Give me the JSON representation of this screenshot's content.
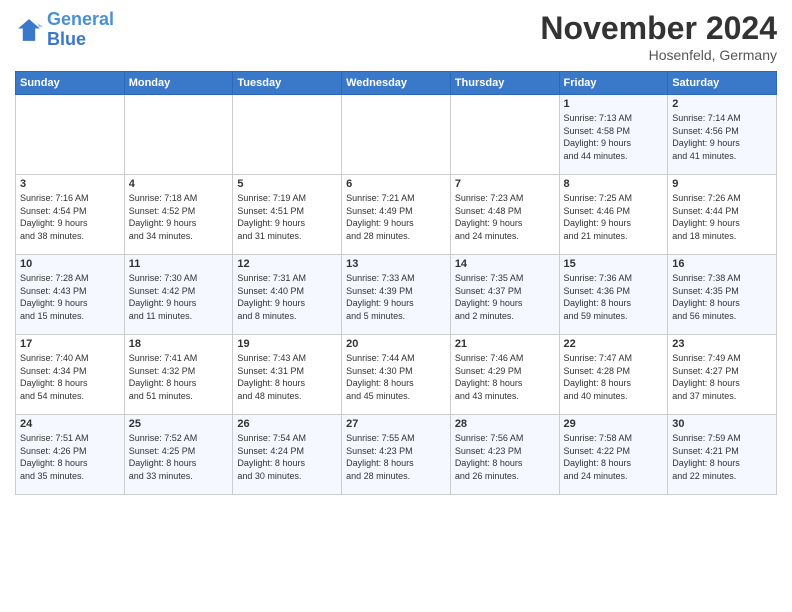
{
  "header": {
    "logo_line1": "General",
    "logo_line2": "Blue",
    "month_title": "November 2024",
    "location": "Hosenfeld, Germany"
  },
  "days_of_week": [
    "Sunday",
    "Monday",
    "Tuesday",
    "Wednesday",
    "Thursday",
    "Friday",
    "Saturday"
  ],
  "weeks": [
    [
      {
        "day": "",
        "info": ""
      },
      {
        "day": "",
        "info": ""
      },
      {
        "day": "",
        "info": ""
      },
      {
        "day": "",
        "info": ""
      },
      {
        "day": "",
        "info": ""
      },
      {
        "day": "1",
        "info": "Sunrise: 7:13 AM\nSunset: 4:58 PM\nDaylight: 9 hours\nand 44 minutes."
      },
      {
        "day": "2",
        "info": "Sunrise: 7:14 AM\nSunset: 4:56 PM\nDaylight: 9 hours\nand 41 minutes."
      }
    ],
    [
      {
        "day": "3",
        "info": "Sunrise: 7:16 AM\nSunset: 4:54 PM\nDaylight: 9 hours\nand 38 minutes."
      },
      {
        "day": "4",
        "info": "Sunrise: 7:18 AM\nSunset: 4:52 PM\nDaylight: 9 hours\nand 34 minutes."
      },
      {
        "day": "5",
        "info": "Sunrise: 7:19 AM\nSunset: 4:51 PM\nDaylight: 9 hours\nand 31 minutes."
      },
      {
        "day": "6",
        "info": "Sunrise: 7:21 AM\nSunset: 4:49 PM\nDaylight: 9 hours\nand 28 minutes."
      },
      {
        "day": "7",
        "info": "Sunrise: 7:23 AM\nSunset: 4:48 PM\nDaylight: 9 hours\nand 24 minutes."
      },
      {
        "day": "8",
        "info": "Sunrise: 7:25 AM\nSunset: 4:46 PM\nDaylight: 9 hours\nand 21 minutes."
      },
      {
        "day": "9",
        "info": "Sunrise: 7:26 AM\nSunset: 4:44 PM\nDaylight: 9 hours\nand 18 minutes."
      }
    ],
    [
      {
        "day": "10",
        "info": "Sunrise: 7:28 AM\nSunset: 4:43 PM\nDaylight: 9 hours\nand 15 minutes."
      },
      {
        "day": "11",
        "info": "Sunrise: 7:30 AM\nSunset: 4:42 PM\nDaylight: 9 hours\nand 11 minutes."
      },
      {
        "day": "12",
        "info": "Sunrise: 7:31 AM\nSunset: 4:40 PM\nDaylight: 9 hours\nand 8 minutes."
      },
      {
        "day": "13",
        "info": "Sunrise: 7:33 AM\nSunset: 4:39 PM\nDaylight: 9 hours\nand 5 minutes."
      },
      {
        "day": "14",
        "info": "Sunrise: 7:35 AM\nSunset: 4:37 PM\nDaylight: 9 hours\nand 2 minutes."
      },
      {
        "day": "15",
        "info": "Sunrise: 7:36 AM\nSunset: 4:36 PM\nDaylight: 8 hours\nand 59 minutes."
      },
      {
        "day": "16",
        "info": "Sunrise: 7:38 AM\nSunset: 4:35 PM\nDaylight: 8 hours\nand 56 minutes."
      }
    ],
    [
      {
        "day": "17",
        "info": "Sunrise: 7:40 AM\nSunset: 4:34 PM\nDaylight: 8 hours\nand 54 minutes."
      },
      {
        "day": "18",
        "info": "Sunrise: 7:41 AM\nSunset: 4:32 PM\nDaylight: 8 hours\nand 51 minutes."
      },
      {
        "day": "19",
        "info": "Sunrise: 7:43 AM\nSunset: 4:31 PM\nDaylight: 8 hours\nand 48 minutes."
      },
      {
        "day": "20",
        "info": "Sunrise: 7:44 AM\nSunset: 4:30 PM\nDaylight: 8 hours\nand 45 minutes."
      },
      {
        "day": "21",
        "info": "Sunrise: 7:46 AM\nSunset: 4:29 PM\nDaylight: 8 hours\nand 43 minutes."
      },
      {
        "day": "22",
        "info": "Sunrise: 7:47 AM\nSunset: 4:28 PM\nDaylight: 8 hours\nand 40 minutes."
      },
      {
        "day": "23",
        "info": "Sunrise: 7:49 AM\nSunset: 4:27 PM\nDaylight: 8 hours\nand 37 minutes."
      }
    ],
    [
      {
        "day": "24",
        "info": "Sunrise: 7:51 AM\nSunset: 4:26 PM\nDaylight: 8 hours\nand 35 minutes."
      },
      {
        "day": "25",
        "info": "Sunrise: 7:52 AM\nSunset: 4:25 PM\nDaylight: 8 hours\nand 33 minutes."
      },
      {
        "day": "26",
        "info": "Sunrise: 7:54 AM\nSunset: 4:24 PM\nDaylight: 8 hours\nand 30 minutes."
      },
      {
        "day": "27",
        "info": "Sunrise: 7:55 AM\nSunset: 4:23 PM\nDaylight: 8 hours\nand 28 minutes."
      },
      {
        "day": "28",
        "info": "Sunrise: 7:56 AM\nSunset: 4:23 PM\nDaylight: 8 hours\nand 26 minutes."
      },
      {
        "day": "29",
        "info": "Sunrise: 7:58 AM\nSunset: 4:22 PM\nDaylight: 8 hours\nand 24 minutes."
      },
      {
        "day": "30",
        "info": "Sunrise: 7:59 AM\nSunset: 4:21 PM\nDaylight: 8 hours\nand 22 minutes."
      }
    ]
  ]
}
